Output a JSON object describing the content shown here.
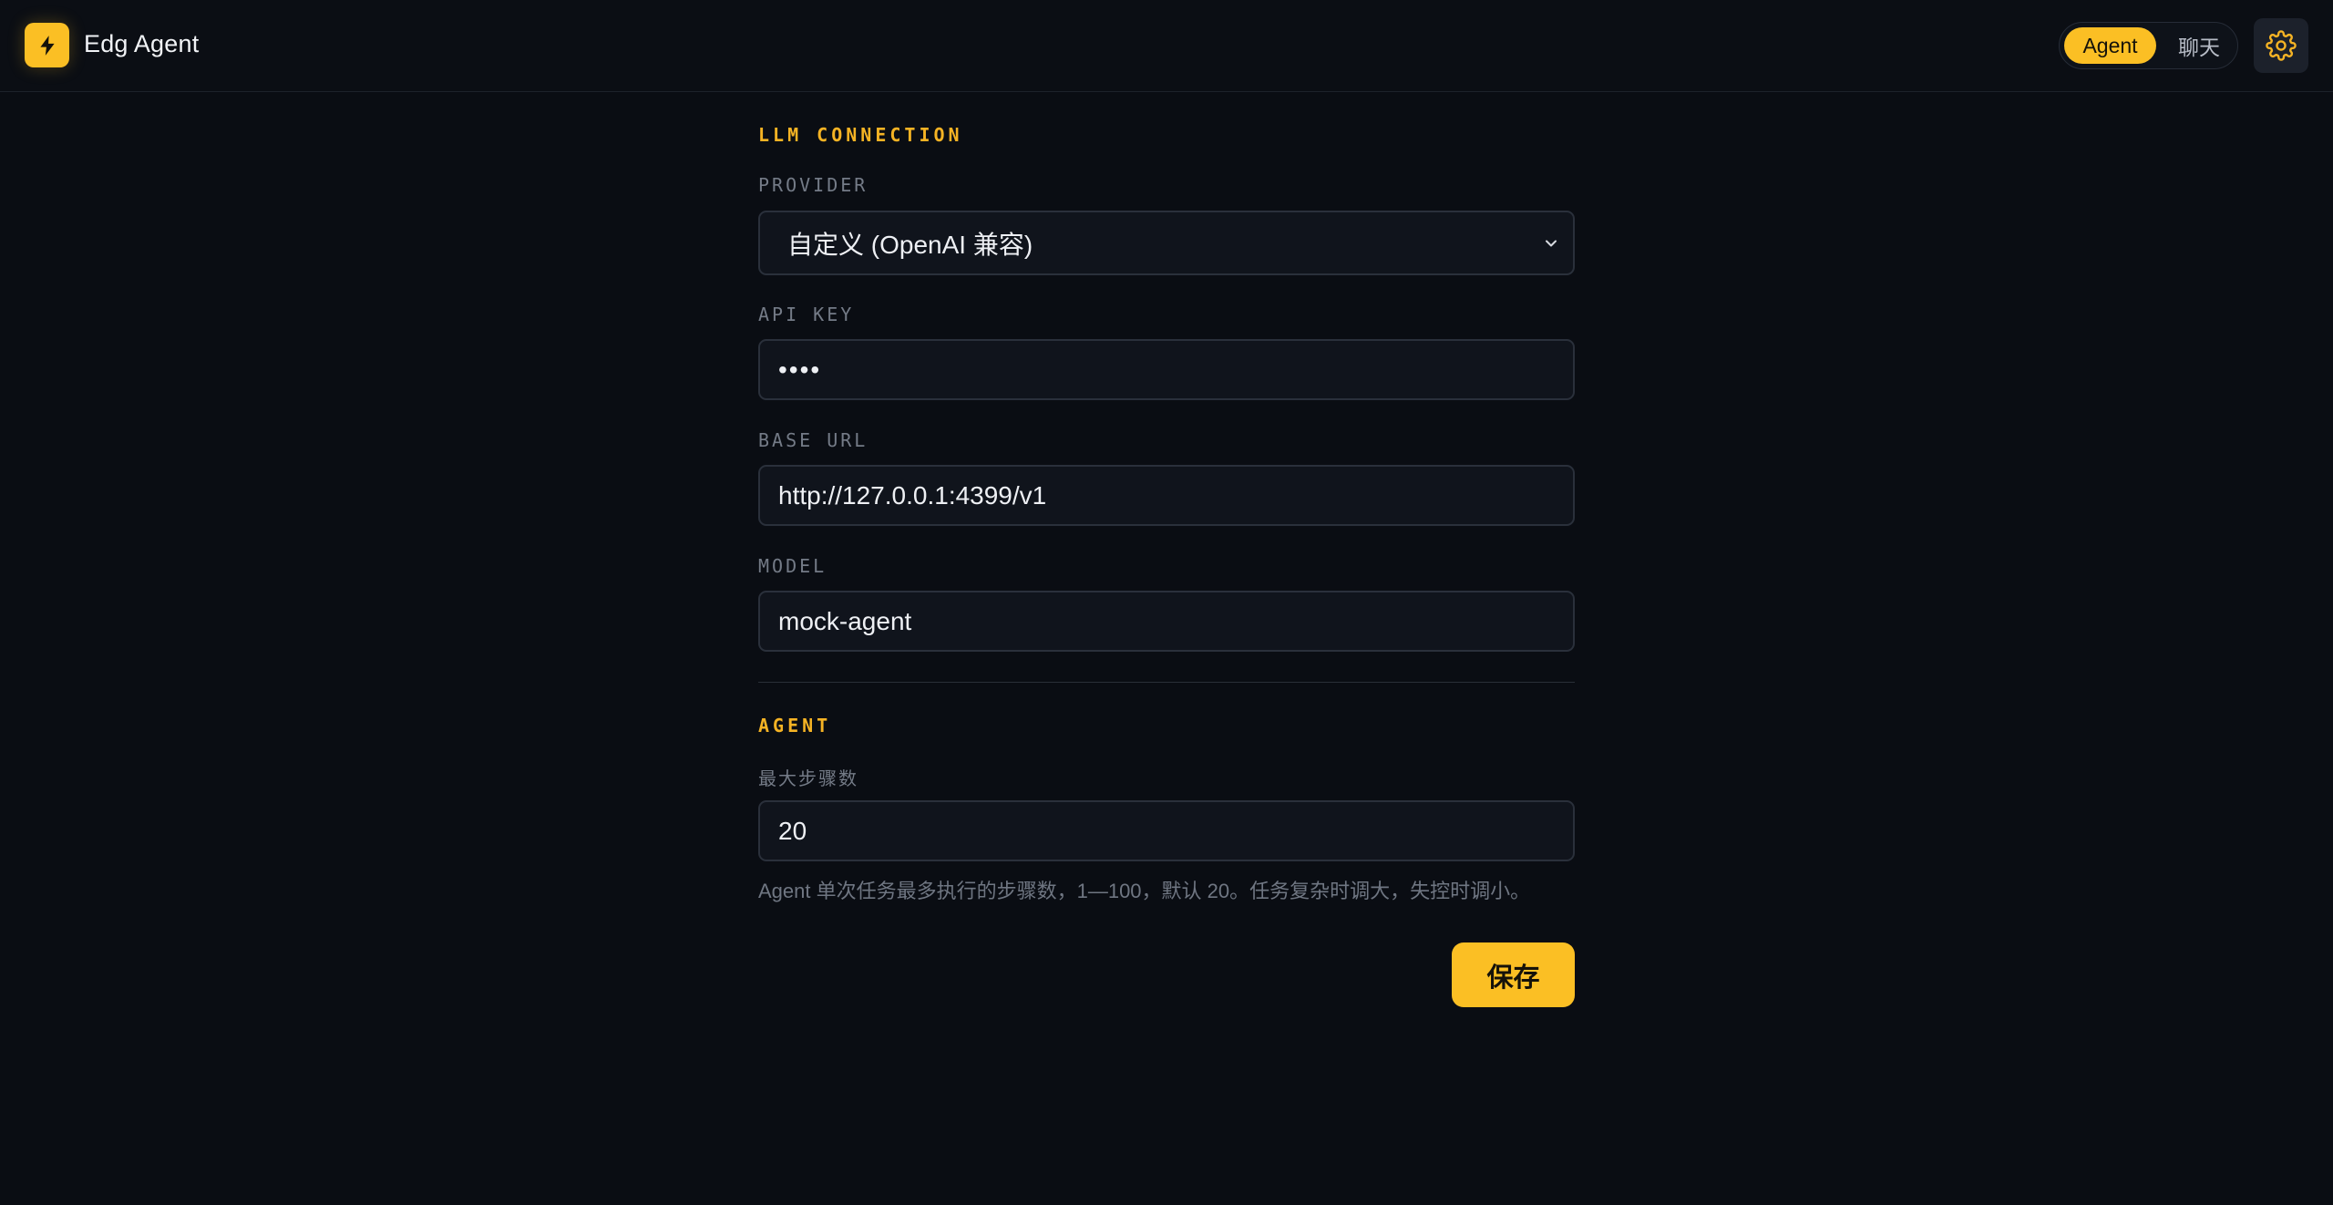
{
  "header": {
    "app_title": "Edg Agent",
    "logo_icon": "lightning-bolt-icon",
    "modes": [
      {
        "label": "Agent",
        "active": true
      },
      {
        "label": "聊天",
        "active": false
      }
    ],
    "settings_icon": "gear-icon",
    "accent_color": "#fbbf24"
  },
  "llm_connection": {
    "section_title": "LLM CONNECTION",
    "provider": {
      "label": "PROVIDER",
      "value": "自定义 (OpenAI 兼容)"
    },
    "api_key": {
      "label": "API KEY",
      "value": "••••"
    },
    "base_url": {
      "label": "BASE URL",
      "value": "http://127.0.0.1:4399/v1"
    },
    "model": {
      "label": "MODEL",
      "value": "mock-agent"
    }
  },
  "agent": {
    "section_title": "AGENT",
    "max_steps": {
      "label": "最大步骤数",
      "value": "20",
      "hint": "Agent 单次任务最多执行的步骤数，1—100，默认 20。任务复杂时调大，失控时调小。"
    }
  },
  "actions": {
    "save_label": "保存"
  }
}
